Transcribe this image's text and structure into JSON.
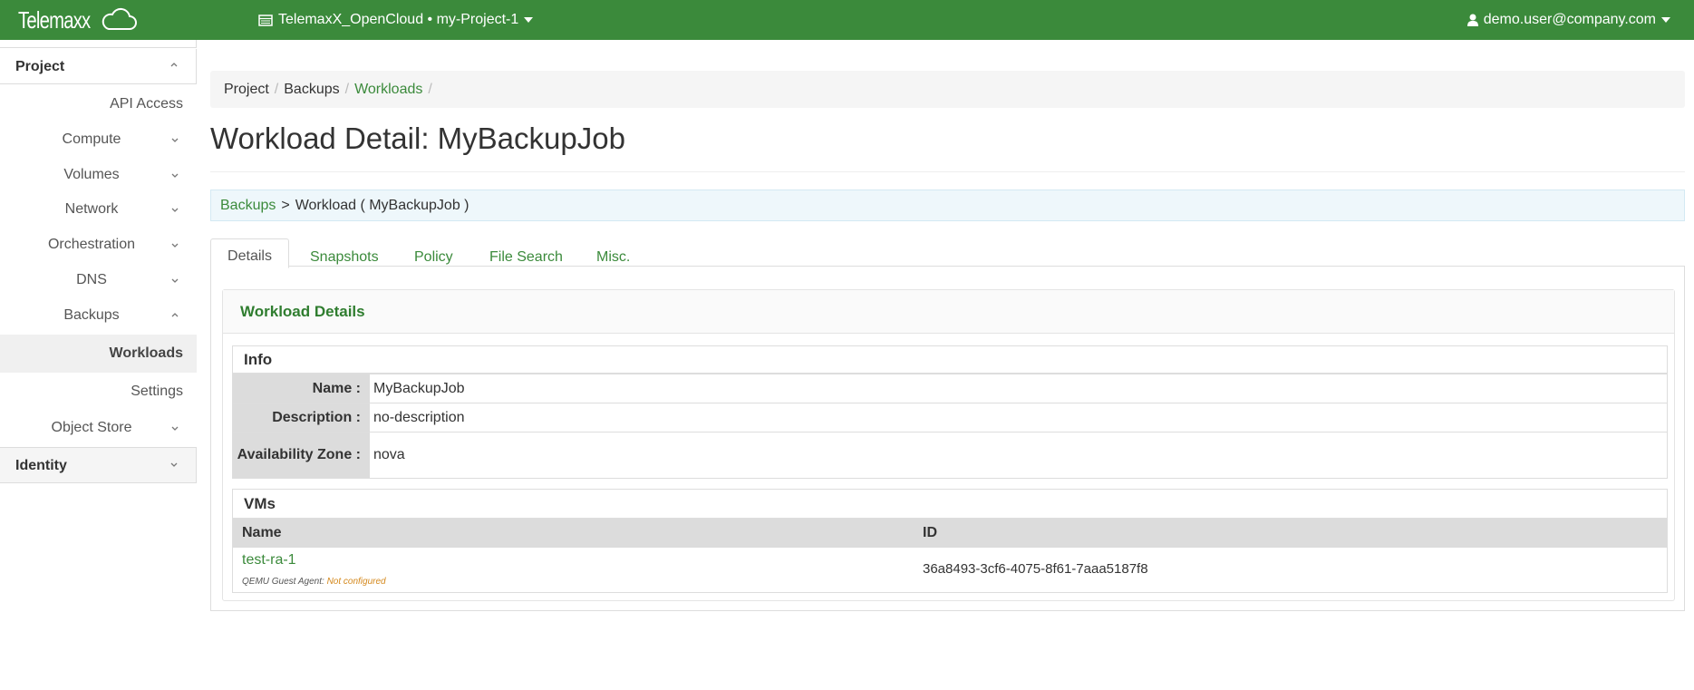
{
  "topbar": {
    "brand": "Telemaxx",
    "project_switch": "TelemaxX_OpenCloud • my-Project-1",
    "user": "demo.user@company.com"
  },
  "sidebar": {
    "sections": {
      "project": "Project",
      "identity": "Identity"
    },
    "items": [
      {
        "label": "API Access"
      },
      {
        "label": "Compute"
      },
      {
        "label": "Volumes"
      },
      {
        "label": "Network"
      },
      {
        "label": "Orchestration"
      },
      {
        "label": "DNS"
      },
      {
        "label": "Backups"
      },
      {
        "label": "Workloads"
      },
      {
        "label": "Settings"
      },
      {
        "label": "Object Store"
      }
    ]
  },
  "breadcrumb": [
    "Project",
    "Backups",
    "Workloads"
  ],
  "page_title": "Workload Detail: MyBackupJob",
  "info_bar": {
    "link": "Backups",
    "separator": ">",
    "text": "Workload ( MyBackupJob )"
  },
  "tabs": [
    "Details",
    "Snapshots",
    "Policy",
    "File Search",
    "Misc."
  ],
  "details": {
    "card_title": "Workload Details",
    "info": {
      "title": "Info",
      "rows": [
        {
          "key": "Name :",
          "value": "MyBackupJob"
        },
        {
          "key": "Description :",
          "value": "no-description"
        },
        {
          "key": "Availability Zone :",
          "value": "nova"
        }
      ]
    },
    "vms": {
      "title": "VMs",
      "columns": [
        "Name",
        "ID"
      ],
      "rows": [
        {
          "name": "test-ra-1",
          "agent_label": "QEMU Guest Agent:",
          "agent_status": "Not configured",
          "id": "36a8493-3cf6-4075-8f61-7aaa5187f8"
        }
      ]
    }
  },
  "colors": {
    "brand_green": "#3b8a3b",
    "link_green": "#3b8a3b",
    "warning": "#d4881c"
  }
}
